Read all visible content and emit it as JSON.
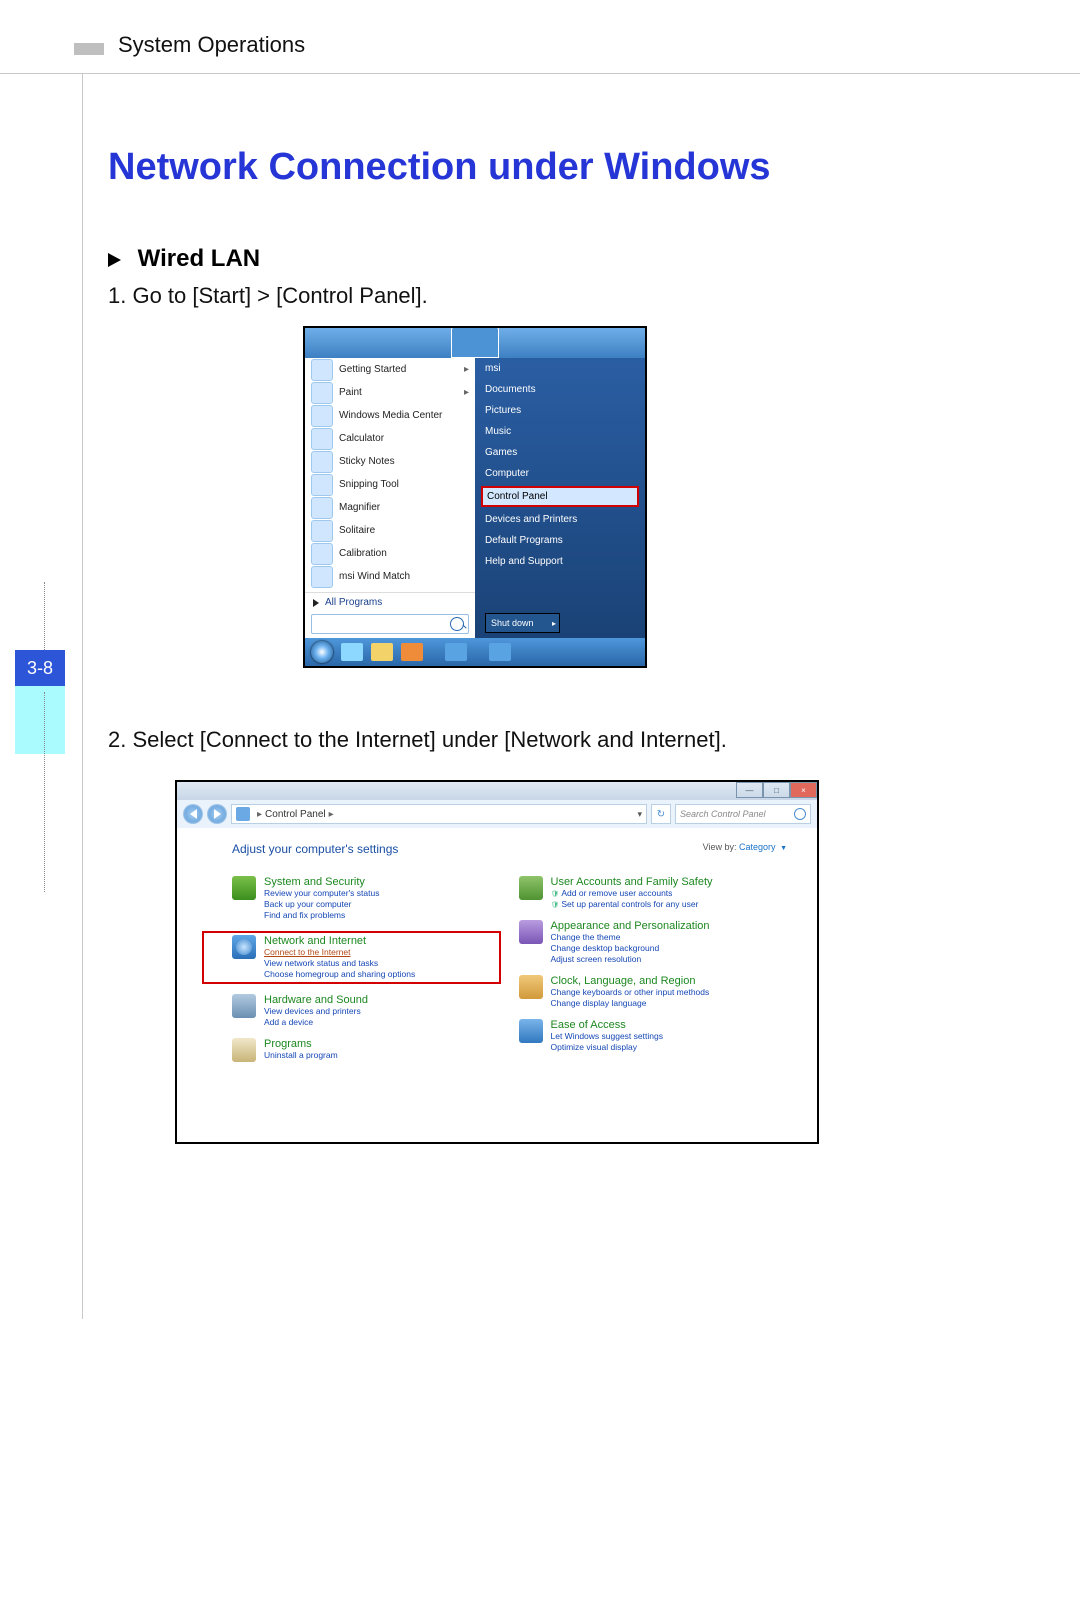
{
  "header": {
    "section": "System Operations"
  },
  "title": "Network Connection under Windows",
  "subsection": {
    "marker": "➤",
    "title": "Wired LAN"
  },
  "steps": [
    "1.  Go to [Start] > [Control Panel].",
    "2.  Select [Connect to the Internet] under [Network and Internet]."
  ],
  "page_number": "3-8",
  "start_menu": {
    "left_items": [
      {
        "label": "Getting Started",
        "arrow": true
      },
      {
        "label": "Paint",
        "arrow": true
      },
      {
        "label": "Windows Media Center"
      },
      {
        "label": "Calculator"
      },
      {
        "label": "Sticky Notes"
      },
      {
        "label": "Snipping Tool"
      },
      {
        "label": "Magnifier"
      },
      {
        "label": "Solitaire"
      },
      {
        "label": "Calibration"
      },
      {
        "label": "msi Wind Match"
      }
    ],
    "all_programs": "All Programs",
    "right_items": [
      "msi",
      "Documents",
      "Pictures",
      "Music",
      "Games",
      "Computer"
    ],
    "right_highlight": "Control Panel",
    "right_items_after": [
      "Devices and Printers",
      "Default Programs",
      "Help and Support"
    ],
    "shutdown": "Shut down"
  },
  "control_panel": {
    "breadcrumb_label": "Control Panel",
    "breadcrumb_arrow": "▸",
    "search_placeholder": "Search Control Panel",
    "refresh_icon": "↻",
    "adjust": "Adjust your computer's settings",
    "viewby": "View by:",
    "viewby_value": "Category",
    "left": [
      {
        "title": "System and Security",
        "links": [
          "Review your computer's status",
          "Back up your computer",
          "Find and fix problems"
        ],
        "icontype": "ico-sec"
      },
      {
        "title": "Network and Internet",
        "links": [
          "Connect to the Internet",
          "View network status and tasks",
          "Choose homegroup and sharing options"
        ],
        "icontype": "ico-net",
        "hl": true
      },
      {
        "title": "Hardware and Sound",
        "links": [
          "View devices and printers",
          "Add a device"
        ],
        "icontype": "ico-hw"
      },
      {
        "title": "Programs",
        "links": [
          "Uninstall a program"
        ],
        "icontype": "ico-prog"
      }
    ],
    "right": [
      {
        "title": "User Accounts and Family Safety",
        "links": [
          "Add or remove user accounts",
          "Set up parental controls for any user"
        ],
        "shield": true,
        "icontype": "ico-user"
      },
      {
        "title": "Appearance and Personalization",
        "links": [
          "Change the theme",
          "Change desktop background",
          "Adjust screen resolution"
        ],
        "icontype": "ico-appear"
      },
      {
        "title": "Clock, Language, and Region",
        "links": [
          "Change keyboards or other input methods",
          "Change display language"
        ],
        "icontype": "ico-clock"
      },
      {
        "title": "Ease of Access",
        "links": [
          "Let Windows suggest settings",
          "Optimize visual display"
        ],
        "icontype": "ico-ease"
      }
    ],
    "win_min": "—",
    "win_max": "□",
    "win_close": "×"
  }
}
